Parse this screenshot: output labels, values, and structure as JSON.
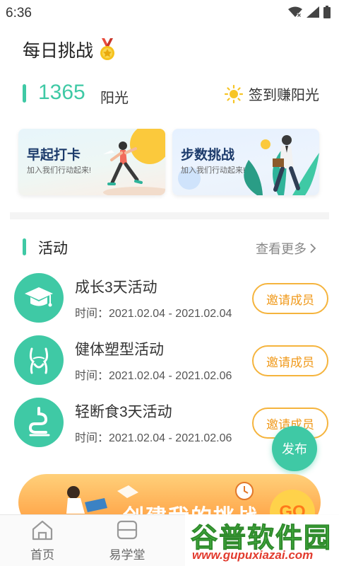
{
  "status_bar": {
    "time": "6:36"
  },
  "header": {
    "title": "每日挑战",
    "medal_icon": "medal-icon"
  },
  "points": {
    "value": "1365",
    "unit": "阳光",
    "signin_label": "签到赚阳光",
    "sun_icon": "sun-icon"
  },
  "cards": [
    {
      "title": "早起打卡",
      "subtitle": "加入我们行动起来!"
    },
    {
      "title": "步数挑战",
      "subtitle": "加入我们行动起来!"
    }
  ],
  "activities_section": {
    "title": "活动",
    "more_label": "查看更多"
  },
  "activities": [
    {
      "name": "成长3天活动",
      "time": "时间：2021.02.04 - 2021.02.04",
      "button": "邀请成员",
      "icon": "graduation-cap-icon"
    },
    {
      "name": "健体塑型活动",
      "time": "时间：2021.02.04 - 2021.02.06",
      "button": "邀请成员",
      "icon": "body-shape-icon"
    },
    {
      "name": "轻断食3天活动",
      "time": "时间：2021.02.04 - 2021.02.06",
      "button": "邀请成员",
      "icon": "stomach-icon"
    }
  ],
  "fab": {
    "label": "发布"
  },
  "banner": {
    "text": "创建我的挑战",
    "go_label": "GO"
  },
  "tabs": [
    {
      "label": "首页",
      "icon": "home-icon"
    },
    {
      "label": "易学堂",
      "icon": "book-icon"
    }
  ],
  "watermark": {
    "main": "谷普软件园",
    "url": "www.gupuxiazai.com"
  },
  "colors": {
    "accent": "#3fc9a5",
    "invite_border": "#f5b43d",
    "invite_text": "#f09a1c",
    "banner": "#ff9a3c"
  }
}
